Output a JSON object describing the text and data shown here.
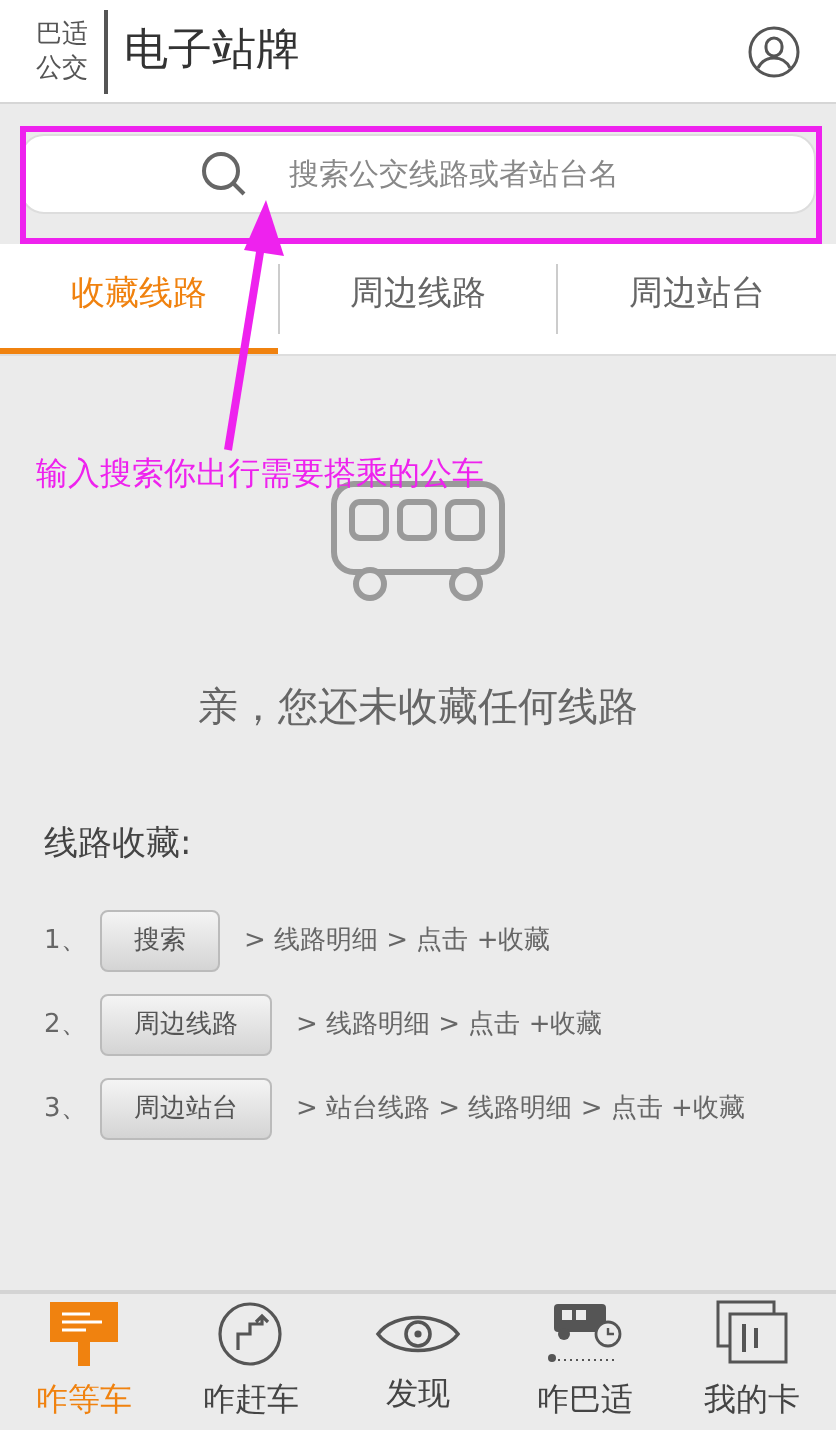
{
  "header": {
    "logo_line_1": "巴适",
    "logo_line_2": "公交",
    "title": "电子站牌"
  },
  "search": {
    "placeholder": "搜索公交线路或者站台名"
  },
  "tabs": [
    {
      "label": "收藏线路",
      "selected": true
    },
    {
      "label": "周边线路",
      "selected": false
    },
    {
      "label": "周边站台",
      "selected": false
    }
  ],
  "empty_message": "亲，您还未收藏任何线路",
  "guide": {
    "title": "线路收藏:",
    "steps": [
      {
        "number": "1、",
        "button": "搜索",
        "path": "> 线路明细 > 点击 +收藏"
      },
      {
        "number": "2、",
        "button": "周边线路",
        "path": "> 线路明细 > 点击 +收藏"
      },
      {
        "number": "3、",
        "button": "周边站台",
        "path": "> 站台线路 > 线路明细 > 点击 +收藏"
      }
    ]
  },
  "bottom_nav": [
    {
      "label": "咋等车",
      "kind": "sign",
      "selected": true
    },
    {
      "label": "咋赶车",
      "kind": "route",
      "selected": false
    },
    {
      "label": "发现",
      "kind": "eye",
      "selected": false
    },
    {
      "label": "咋巴适",
      "kind": "bus",
      "selected": false
    },
    {
      "label": "我的卡",
      "kind": "card",
      "selected": false
    }
  ],
  "annotation": {
    "text": "输入搜索你出行需要搭乘的公车"
  }
}
